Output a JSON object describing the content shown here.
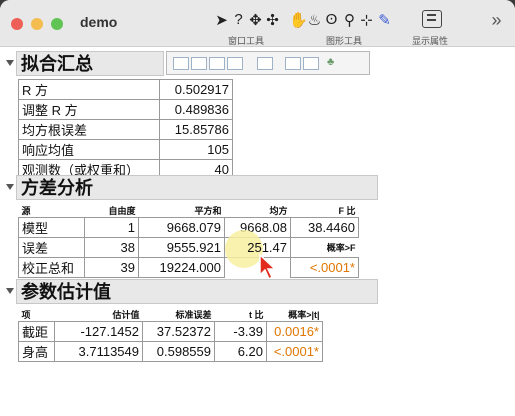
{
  "window": {
    "title": "demo"
  },
  "toolbar": {
    "tools": [
      {
        "icon": "arrow-icon",
        "glyph": "➤"
      },
      {
        "icon": "help-icon",
        "glyph": "?"
      },
      {
        "icon": "crosshair-icon",
        "glyph": "✥"
      },
      {
        "icon": "move-icon",
        "glyph": "✣"
      },
      {
        "icon": "hand-icon",
        "glyph": "✋"
      },
      {
        "icon": "brush-icon",
        "glyph": "♨"
      },
      {
        "icon": "lasso-icon",
        "glyph": "ʘ"
      },
      {
        "icon": "magnifier-icon",
        "glyph": "⚲"
      },
      {
        "icon": "scaler-icon",
        "glyph": "⊹"
      },
      {
        "icon": "pen-icon",
        "glyph": "✎"
      }
    ],
    "group_window": "窗口工具",
    "group_graph": "图形工具",
    "group_display": "显示属性",
    "more_glyph": "»"
  },
  "fit_summary": {
    "title": "拟合汇总",
    "rows": [
      {
        "label": "R 方",
        "value": "0.502917"
      },
      {
        "label": "调整 R 方",
        "value": "0.489836"
      },
      {
        "label": "均方根误差",
        "value": "15.85786"
      },
      {
        "label": "响应均值",
        "value": "105"
      },
      {
        "label": "观测数（或权重和）",
        "value": "40"
      }
    ]
  },
  "anova": {
    "title": "方差分析",
    "headers": {
      "source": "源",
      "df": "自由度",
      "ss": "平方和",
      "ms": "均方",
      "f": "F 比"
    },
    "rows": [
      {
        "source": "模型",
        "df": "1",
        "ss": "9668.079",
        "ms": "9668.08",
        "f": "38.4460"
      },
      {
        "source": "误差",
        "df": "38",
        "ss": "9555.921",
        "ms": "251.47",
        "f": "概率>F"
      },
      {
        "source": "校正总和",
        "df": "39",
        "ss": "19224.000",
        "ms": "",
        "f": "<.0001*"
      }
    ]
  },
  "params": {
    "title": "参数估计值",
    "headers": {
      "term": "项",
      "est": "估计值",
      "se": "标准误差",
      "t": "t 比",
      "p": "概率>|t|"
    },
    "rows": [
      {
        "term": "截距",
        "est": "-127.1452",
        "se": "37.52372",
        "t": "-3.39",
        "p": "0.0016*"
      },
      {
        "term": "身高",
        "est": "3.7113549",
        "se": "0.598559",
        "t": "6.20",
        "p": "<.0001*"
      }
    ]
  },
  "colors": {
    "close": "#ee5f57",
    "minimize": "#f5bd4f",
    "zoom": "#5fc454",
    "highlight": "#f7f0a0",
    "cursor": "#e32b1d",
    "orange": "#e07700"
  }
}
